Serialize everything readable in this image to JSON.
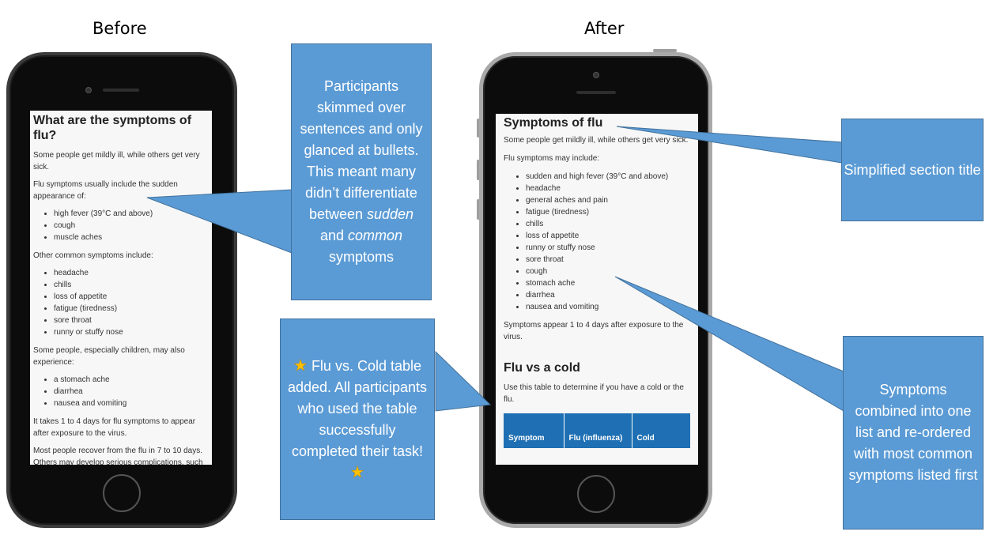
{
  "headings": {
    "before": "Before",
    "after": "After"
  },
  "before_screen": {
    "title": "What are the symptoms of flu?",
    "intro": "Some people get mildly ill, while others get very sick.",
    "usual_intro": "Flu symptoms usually include the sudden appearance of:",
    "usual_items": [
      "high fever (39°C and above)",
      "cough",
      "muscle aches"
    ],
    "common_intro": "Other common symptoms include:",
    "common_items": [
      "headache",
      "chills",
      "loss of appetite",
      "fatigue (tiredness)",
      "sore throat",
      "runny or stuffy nose"
    ],
    "children_intro": "Some people, especially children, may also experience:",
    "children_items": [
      "a stomach ache",
      "diarrhea",
      "nausea and vomiting"
    ],
    "onset": "It takes 1 to 4 days for flu symptoms to appear after exposure to the virus.",
    "recovery": "Most people recover from the flu in 7 to 10 days. Others may develop serious complications, such"
  },
  "after_screen": {
    "title": "Symptoms of flu",
    "intro": "Some people get mildly ill, while others get very sick.",
    "list_intro": "Flu symptoms may include:",
    "items": [
      "sudden and high fever (39°C and above)",
      "headache",
      "general aches and pain",
      "fatigue (tiredness)",
      "chills",
      "loss of appetite",
      "runny or stuffy nose",
      "sore throat",
      "cough",
      "stomach ache",
      "diarrhea",
      "nausea and vomiting"
    ],
    "onset": "Symptoms appear 1 to 4 days after exposure to the virus.",
    "table_heading": "Flu vs a cold",
    "table_intro": "Use this table to determine if you have a cold or the flu.",
    "table_headers": [
      "Symptom",
      "Flu (influenza)",
      "Cold"
    ]
  },
  "callouts": {
    "skimmed": {
      "before": "Participants skimmed over sentences and only glanced at bullets. This meant many didn’t differentiate between ",
      "em1": "sudden",
      "mid": " and ",
      "em2": "common",
      "after": " symptoms"
    },
    "table_added": {
      "text": "Flu vs. Cold table added. All participants who used the table successfully completed their task!",
      "star_icon": "star-icon",
      "star_color": "#ffc000"
    },
    "title": "Simplified section title",
    "combined": "Symptoms combined into one list and re-ordered with most common symptoms listed first"
  },
  "colors": {
    "callout_fill": "#5b9bd5",
    "callout_border": "#41719c",
    "table_header": "#1e6fb3"
  }
}
